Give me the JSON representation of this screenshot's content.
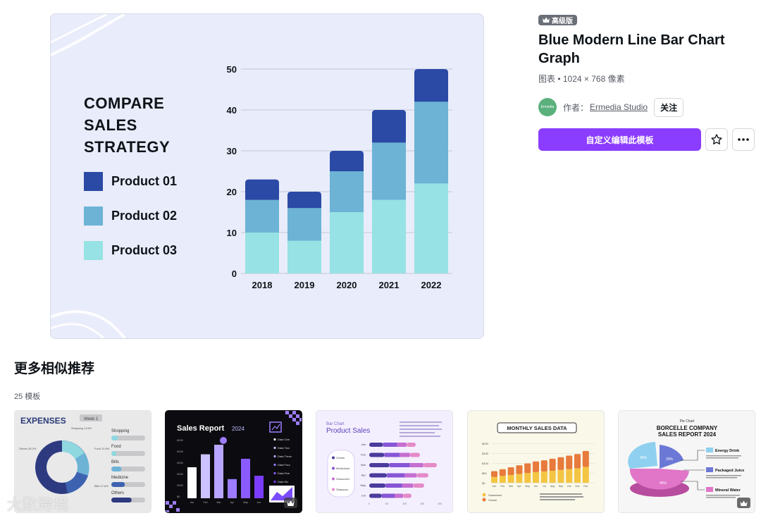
{
  "preview": {
    "title": "COMPARE\nSALES\nSTRATEGY",
    "legend": [
      {
        "label": "Product 01",
        "color": "#2a4aa6"
      },
      {
        "label": "Product 02",
        "color": "#6cb3d6"
      },
      {
        "label": "Product 03",
        "color": "#97e2e4"
      }
    ]
  },
  "chart_data": {
    "type": "bar",
    "stacked": true,
    "categories": [
      "2018",
      "2019",
      "2020",
      "2021",
      "2022"
    ],
    "series": [
      {
        "name": "Product 03",
        "values": [
          10,
          8,
          15,
          18,
          22
        ],
        "color": "#97e2e4"
      },
      {
        "name": "Product 02",
        "values": [
          8,
          8,
          10,
          14,
          20
        ],
        "color": "#6cb3d6"
      },
      {
        "name": "Product 01",
        "values": [
          5,
          4,
          5,
          8,
          8
        ],
        "color": "#2a4aa6"
      }
    ],
    "yticks": [
      "0",
      "10",
      "20",
      "30",
      "40",
      "50"
    ],
    "ylim": [
      0,
      50
    ],
    "grid": true
  },
  "info": {
    "badge": "高级版",
    "title": "Blue Modern Line Bar Chart Graph",
    "meta": "图表 • 1024 × 768 像素",
    "avatar_text": "Ermedia",
    "author_prefix": "作者：",
    "author_name": "Ermedia Studio",
    "follow_label": "关注",
    "primary_button": "自定义编辑此模板"
  },
  "more": {
    "title": "更多相似推荐",
    "count": "25 模板",
    "cards": [
      {
        "title": "EXPENSES",
        "tag": "Week 1",
        "donut_labels": [
          "Shopping 11.8%",
          "Food 11.8%",
          "Bills 17.6%",
          "Others 35.3%"
        ],
        "bars": [
          {
            "label": "Shopping",
            "fill": 0.2
          },
          {
            "label": "Food",
            "fill": 0.15
          },
          {
            "label": "Bills",
            "fill": 0.3
          },
          {
            "label": "Medicine",
            "fill": 0.4
          },
          {
            "label": "Others",
            "fill": 0.6
          }
        ]
      },
      {
        "title": "Sales Report",
        "year": "2024",
        "months": [
          "Jan",
          "Feb",
          "Mar",
          "Apr",
          "May",
          "Jun"
        ],
        "yticks": [
          "6000",
          "5000",
          "4000",
          "3000",
          "2000",
          "$0"
        ],
        "values": [
          0.55,
          0.78,
          0.95,
          0.34,
          0.7,
          0.4
        ],
        "legend": [
          "Data One",
          "Data Two",
          "Data Three",
          "Data Four",
          "Data Five",
          "Data Six"
        ]
      },
      {
        "subtitle": "Bar Chart",
        "title": "Product Sales",
        "legend": [
          "Cream",
          "Moisturizer",
          "Sunscreen",
          "Shampoo"
        ],
        "months": [
          "Jan",
          "Feb",
          "Mar",
          "Apr",
          "May",
          "Jun"
        ],
        "values": [
          0.55,
          0.6,
          0.8,
          0.7,
          0.65,
          0.5
        ],
        "xticks": [
          "0",
          "50",
          "100",
          "150",
          "200"
        ]
      },
      {
        "title": "MONTHLY SALES DATA",
        "months": [
          "Jan",
          "Feb",
          "Mar",
          "Apr",
          "May",
          "Jun",
          "Jul",
          "Aug",
          "Sep",
          "Oct",
          "Nov",
          "Dec"
        ],
        "yticks": [
          "$200",
          "$150",
          "$100",
          "$50",
          "$0"
        ],
        "values": [
          0.3,
          0.35,
          0.4,
          0.45,
          0.5,
          0.55,
          0.58,
          0.62,
          0.66,
          0.7,
          0.74,
          0.82
        ],
        "legend": [
          "Sunscreen",
          "Cream"
        ]
      },
      {
        "subtitle": "Pie Chart",
        "title": "BORCELLE COMPANY SALES REPORT 2024",
        "slices": [
          "35%",
          "20%",
          "45%"
        ],
        "legend": [
          "Energy Drink",
          "Packaged Juice",
          "Mineral Water"
        ]
      }
    ]
  },
  "watermark": "大数跨境"
}
